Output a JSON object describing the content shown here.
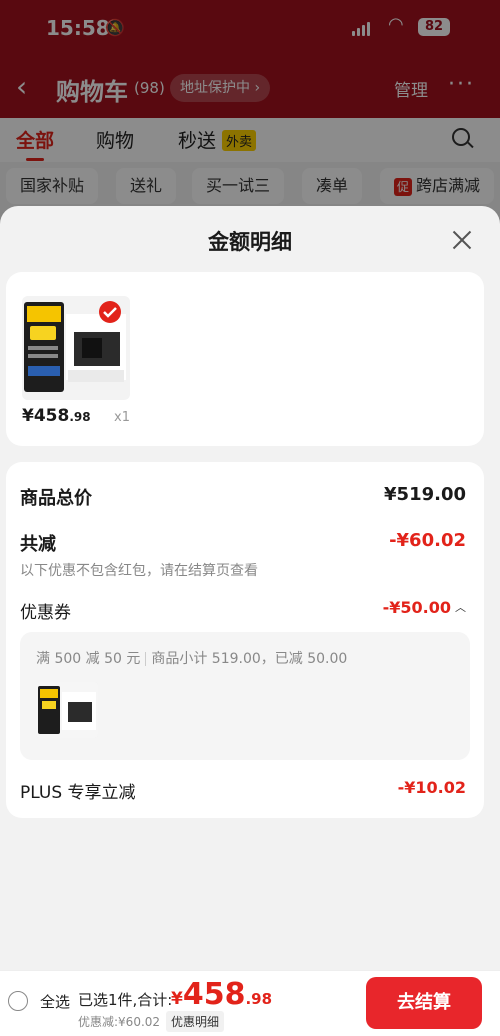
{
  "status_bar": {
    "time": "15:58",
    "battery": "82"
  },
  "nav": {
    "back_icon": "chevron-left-icon",
    "title": "购物车",
    "count": "(98)",
    "address_protection": "地址保护中",
    "manage": "管理",
    "more": "···"
  },
  "tabs": [
    {
      "label": "全部",
      "active": true
    },
    {
      "label": "购物"
    },
    {
      "label": "秒送"
    }
  ],
  "tab_badge": "外卖",
  "chips": [
    "国家补贴",
    "送礼",
    "买一试三",
    "凑单",
    "跨店满减"
  ],
  "chip_promo_tag": "促",
  "sheet": {
    "title": "金额明细",
    "product": {
      "price_int": "¥458",
      "price_dec": ".98",
      "qty": "x1"
    },
    "total_label": "商品总价",
    "total_value": "¥519.00",
    "reduce_label": "共减",
    "reduce_value": "-¥60.02",
    "note": "以下优惠不包含红包，请在结算页查看",
    "coupon_label": "优惠券",
    "coupon_value": "-¥50.00",
    "coupon_rule": "满 500 减 50 元",
    "coupon_subtotal": "商品小计 519.00，已减 50.00",
    "plus_label": "PLUS 专享立减",
    "plus_value": "-¥10.02"
  },
  "bottom": {
    "select_all": "全选",
    "selected_text": "已选1件,合计:",
    "total_symbol": "¥",
    "total_int": "458",
    "total_dec": ".98",
    "discount": "优惠减:¥60.02",
    "detail_link": "优惠明细",
    "checkout": "去结算"
  },
  "colors": {
    "brand_red": "#e2231a",
    "header_red": "#a3111e"
  }
}
